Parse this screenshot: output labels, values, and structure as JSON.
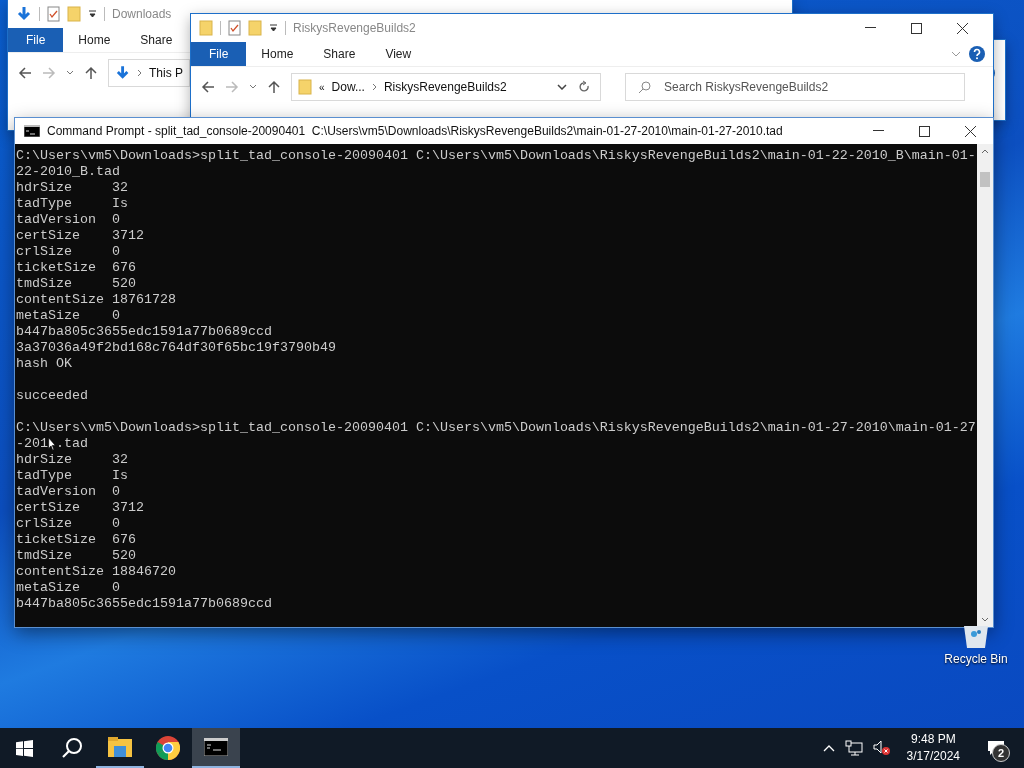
{
  "back_explorer": {
    "title": "Downloads",
    "ribbon_tabs": [
      {
        "kind": "file",
        "label": "File"
      },
      {
        "kind": "tab",
        "label": "Home"
      },
      {
        "kind": "tab",
        "label": "Share"
      }
    ],
    "address": "This P"
  },
  "front_explorer": {
    "title": "RiskysRevengeBuilds2",
    "ribbon_tabs": [
      {
        "kind": "file",
        "label": "File"
      },
      {
        "kind": "tab",
        "label": "Home"
      },
      {
        "kind": "tab",
        "label": "Share"
      },
      {
        "kind": "tab",
        "label": "View"
      }
    ],
    "address_overflow": "«",
    "address_parts": [
      "Dow...",
      "RiskysRevengeBuilds2"
    ],
    "search": {
      "placeholder": "Search RiskysRevengeBuilds2"
    }
  },
  "command_prompt": {
    "title": "Command Prompt - split_tad_console-20090401  C:\\Users\\vm5\\Downloads\\RiskysRevengeBuilds2\\main-01-27-2010\\main-01-27-2010.tad",
    "lines": [
      {
        "kind": "text",
        "text": "C:\\Users\\vm5\\Downloads>split_tad_console-20090401 C:\\Users\\vm5\\Downloads\\RiskysRevengeBuilds2\\main-01-22-2010_B\\main-01-"
      },
      {
        "kind": "text",
        "text": "22-2010_B.tad"
      },
      {
        "kind": "text",
        "text": "hdrSize     32"
      },
      {
        "kind": "text",
        "text": "tadType     Is"
      },
      {
        "kind": "text",
        "text": "tadVersion  0"
      },
      {
        "kind": "text",
        "text": "certSize    3712"
      },
      {
        "kind": "text",
        "text": "crlSize     0"
      },
      {
        "kind": "text",
        "text": "ticketSize  676"
      },
      {
        "kind": "text",
        "text": "tmdSize     520"
      },
      {
        "kind": "text",
        "text": "contentSize 18761728"
      },
      {
        "kind": "text",
        "text": "metaSize    0"
      },
      {
        "kind": "text",
        "text": "b447ba805c3655edc1591a77b0689ccd"
      },
      {
        "kind": "text",
        "text": "3a37036a49f2bd168c764df30f65bc19f3790b49"
      },
      {
        "kind": "text",
        "text": "hash OK"
      },
      {
        "kind": "blank"
      },
      {
        "kind": "text",
        "text": "succeeded"
      },
      {
        "kind": "blank"
      },
      {
        "kind": "text",
        "text": "C:\\Users\\vm5\\Downloads>split_tad_console-20090401 C:\\Users\\vm5\\Downloads\\RiskysRevengeBuilds2\\main-01-27-2010\\main-01-27"
      },
      {
        "kind": "split",
        "parts": [
          "-201",
          ".tad"
        ]
      },
      {
        "kind": "text",
        "text": "hdrSize     32"
      },
      {
        "kind": "text",
        "text": "tadType     Is"
      },
      {
        "kind": "text",
        "text": "tadVersion  0"
      },
      {
        "kind": "text",
        "text": "certSize    3712"
      },
      {
        "kind": "text",
        "text": "crlSize     0"
      },
      {
        "kind": "text",
        "text": "ticketSize  676"
      },
      {
        "kind": "text",
        "text": "tmdSize     520"
      },
      {
        "kind": "text",
        "text": "contentSize 18846720"
      },
      {
        "kind": "text",
        "text": "metaSize    0"
      },
      {
        "kind": "text",
        "text": "b447ba805c3655edc1591a77b0689ccd"
      }
    ]
  },
  "desktop_icons": [
    {
      "label": "Recycle Bin"
    }
  ],
  "taskbar": {
    "apps": [
      {
        "kind": "explorer",
        "selected": false,
        "running": true
      },
      {
        "kind": "chrome",
        "selected": false,
        "running": false
      },
      {
        "kind": "terminal",
        "selected": true,
        "running": true
      }
    ],
    "time": "9:48 PM",
    "date": "3/17/2024",
    "notification_count": "2"
  }
}
